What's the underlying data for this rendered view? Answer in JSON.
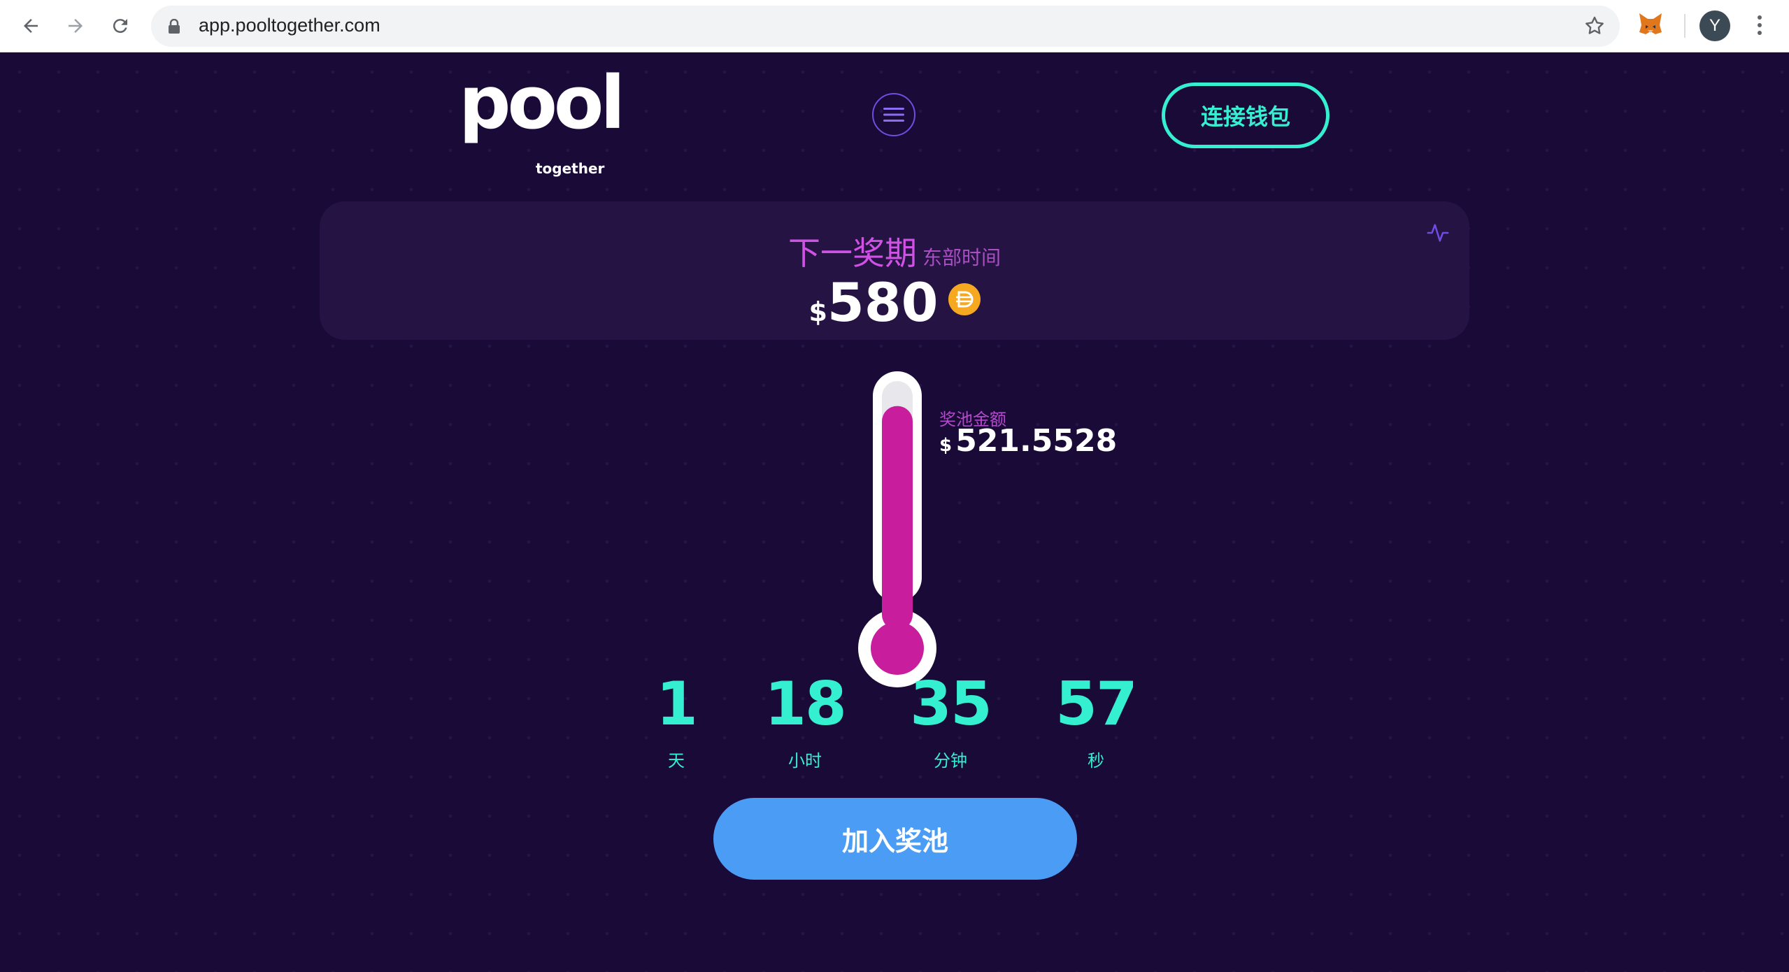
{
  "browser": {
    "url": "app.pooltogether.com",
    "profile_initial": "Y"
  },
  "header": {
    "logo_word": "pool",
    "logo_sub": "together",
    "connect_wallet_label": "连接钱包"
  },
  "prize": {
    "title": "下一奖期",
    "timezone": "东部时间",
    "currency": "$",
    "amount": "580",
    "token_icon": "dai-icon"
  },
  "pool": {
    "label": "奖池金额",
    "currency": "$",
    "value": "521.5528",
    "fill_fraction": 0.9
  },
  "countdown": [
    {
      "value": "1",
      "unit": "天"
    },
    {
      "value": "18",
      "unit": "小时"
    },
    {
      "value": "35",
      "unit": "分钟"
    },
    {
      "value": "57",
      "unit": "秒"
    }
  ],
  "join_label": "加入奖池",
  "colors": {
    "background": "#1a0a38",
    "accent_teal": "#35f0d0",
    "accent_magenta": "#c81e9e",
    "button_blue": "#4a9cf5"
  }
}
